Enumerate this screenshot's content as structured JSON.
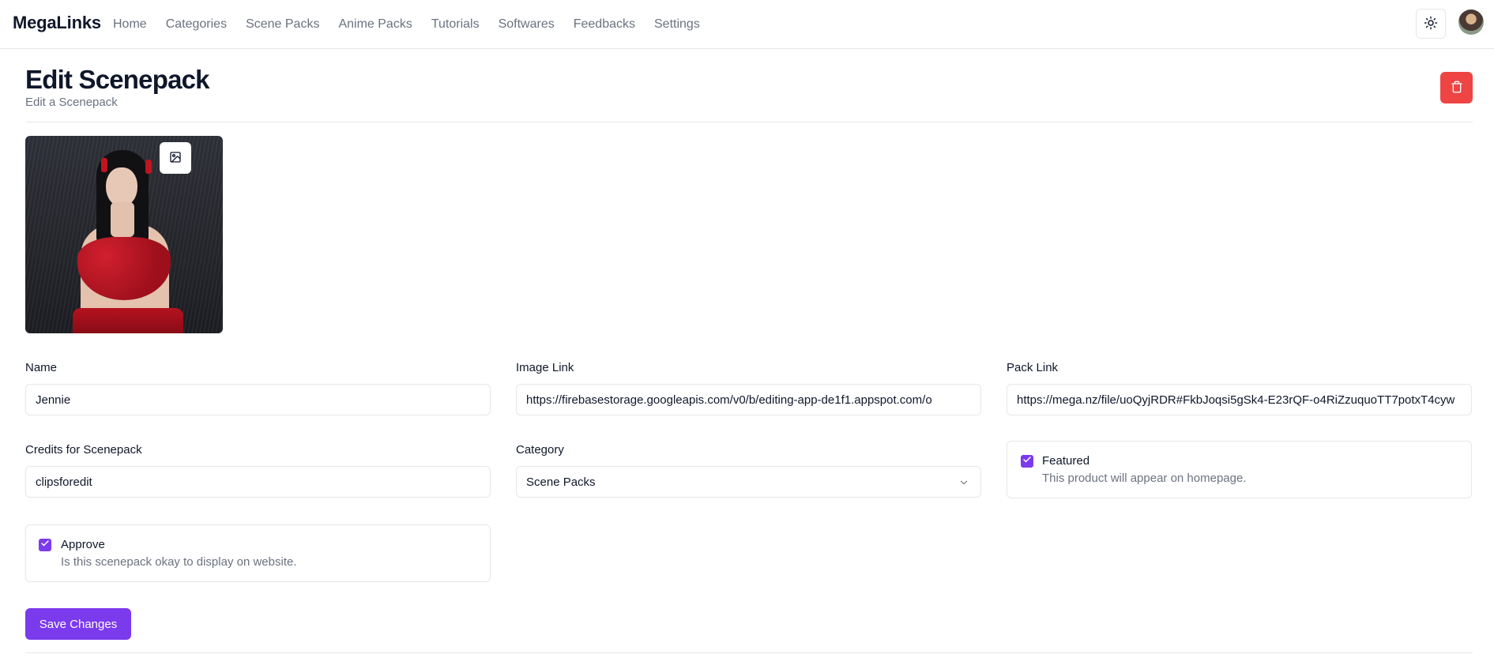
{
  "navbar": {
    "brand": "MegaLinks",
    "links": [
      {
        "label": "Home"
      },
      {
        "label": "Categories"
      },
      {
        "label": "Scene Packs"
      },
      {
        "label": "Anime Packs"
      },
      {
        "label": "Tutorials"
      },
      {
        "label": "Softwares"
      },
      {
        "label": "Feedbacks"
      },
      {
        "label": "Settings"
      }
    ],
    "theme_toggle_icon": "sun-icon",
    "avatar_icon": "user-avatar"
  },
  "header": {
    "title": "Edit Scenepack",
    "subtitle": "Edit a Scenepack",
    "delete_icon": "trash-icon"
  },
  "image": {
    "change_icon": "image-icon"
  },
  "form": {
    "name": {
      "label": "Name",
      "value": "Jennie"
    },
    "image_link": {
      "label": "Image Link",
      "value": "https://firebasestorage.googleapis.com/v0/b/editing-app-de1f1.appspot.com/o"
    },
    "pack_link": {
      "label": "Pack Link",
      "value": "https://mega.nz/file/uoQyjRDR#FkbJoqsi5gSk4-E23rQF-o4RiZzuquoTT7potxT4cyw"
    },
    "credits": {
      "label": "Credits for Scenepack",
      "value": "clipsforedit"
    },
    "category": {
      "label": "Category",
      "value": "Scene Packs"
    },
    "featured": {
      "title": "Featured",
      "description": "This product will appear on homepage.",
      "checked": true
    },
    "approve": {
      "title": "Approve",
      "description": "Is this scenepack okay to display on website.",
      "checked": true
    },
    "save_label": "Save Changes"
  },
  "colors": {
    "accent": "#7c3aed",
    "danger": "#ef4444",
    "border": "#e5e7eb",
    "muted_text": "#6b7280"
  }
}
